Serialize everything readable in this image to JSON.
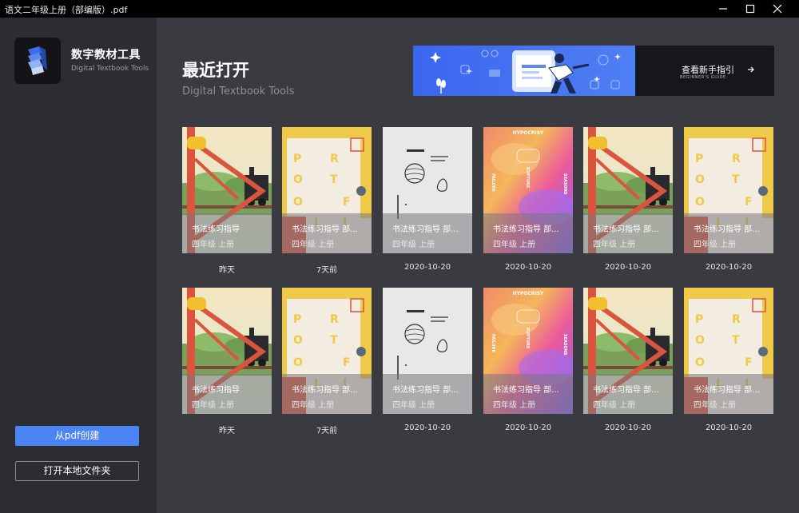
{
  "window": {
    "title": "语文二年级上册（部编版）.pdf"
  },
  "sidebar": {
    "app_name": "数字教材工具",
    "app_subtitle": "Digital Textbook Tools",
    "btn_create": "从pdf创建",
    "btn_open_folder": "打开本地文件夹"
  },
  "main": {
    "title": "最近打开",
    "subtitle": "Digital Textbook Tools"
  },
  "banner": {
    "cta_title": "查看新手指引",
    "cta_subtitle": "BEGINNER'S GUIDE"
  },
  "books": [
    {
      "title": "书法练习指导",
      "grade": "四年级 上册",
      "date": "昨天",
      "style": "train"
    },
    {
      "title": "书法练习指导 部...",
      "grade": "四年级 上册",
      "date": "7天前",
      "style": "portfolio"
    },
    {
      "title": "书法练习指导 部...",
      "grade": "四年级 上册",
      "date": "2020-10-20",
      "style": "sketch"
    },
    {
      "title": "书法练习指导 部...",
      "grade": "四年级 上册",
      "date": "2020-10-20",
      "style": "gradient"
    },
    {
      "title": "书法练习指导 部...",
      "grade": "四年级 上册",
      "date": "2020-10-20",
      "style": "train"
    },
    {
      "title": "书法练习指导 部...",
      "grade": "四年级 上册",
      "date": "2020-10-20",
      "style": "portfolio"
    },
    {
      "title": "书法练习指导",
      "grade": "四年级 上册",
      "date": "昨天",
      "style": "train"
    },
    {
      "title": "书法练习指导 部...",
      "grade": "四年级 上册",
      "date": "7天前",
      "style": "portfolio"
    },
    {
      "title": "书法练习指导 部...",
      "grade": "四年级 上册",
      "date": "2020-10-20",
      "style": "sketch"
    },
    {
      "title": "书法练习指导 部...",
      "grade": "四年级 上册",
      "date": "2020-10-20",
      "style": "gradient"
    },
    {
      "title": "书法练习指导 部...",
      "grade": "四年级 上册",
      "date": "2020-10-20",
      "style": "train"
    },
    {
      "title": "书法练习指导 部...",
      "grade": "四年级 上册",
      "date": "2020-10-20",
      "style": "portfolio"
    }
  ],
  "cover_text": {
    "portfolio_letters": [
      "P",
      "R",
      "O",
      "T",
      "F",
      "O",
      "L",
      "I"
    ],
    "gradient_top": "HYPOCRISY",
    "gradient_left": "FAILURE",
    "gradient_mid": "RUPTURE",
    "gradient_right": "SEASONS"
  },
  "colors": {
    "accent": "#4a84f5",
    "sidebar_bg": "#2c2d31",
    "main_bg": "#3a3b40",
    "titlebar_bg": "#000000"
  }
}
